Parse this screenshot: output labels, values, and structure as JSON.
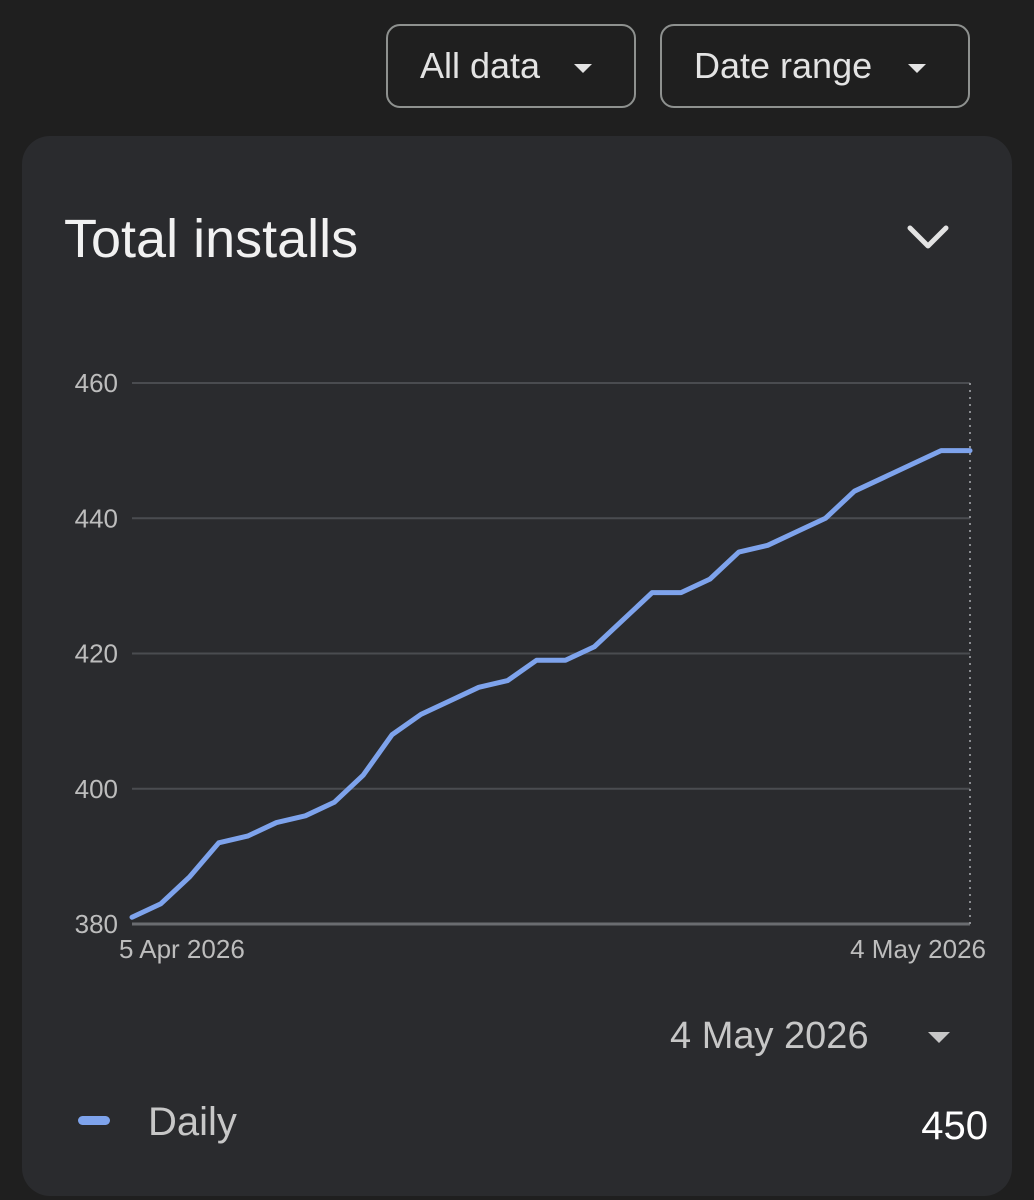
{
  "filters": {
    "all_data_label": "All data",
    "date_range_label": "Date range"
  },
  "card": {
    "title": "Total installs",
    "collapse_icon": "chevron-down-icon"
  },
  "selected_date": "4 May 2026",
  "legend": {
    "label": "Daily",
    "value": "450",
    "color": "#7ea3ec"
  },
  "colors": {
    "background": "#1f1f1f",
    "card": "#2a2b2e",
    "line": "#7ea3ec",
    "grid": "#4a4c50"
  },
  "chart_data": {
    "type": "line",
    "title": "Total installs",
    "xlabel": "",
    "ylabel": "",
    "x_start_label": "5 Apr 2026",
    "x_end_label": "4 May 2026",
    "x": [
      "5 Apr 2026",
      "6 Apr 2026",
      "7 Apr 2026",
      "8 Apr 2026",
      "9 Apr 2026",
      "10 Apr 2026",
      "11 Apr 2026",
      "12 Apr 2026",
      "13 Apr 2026",
      "14 Apr 2026",
      "15 Apr 2026",
      "16 Apr 2026",
      "17 Apr 2026",
      "18 Apr 2026",
      "19 Apr 2026",
      "20 Apr 2026",
      "21 Apr 2026",
      "22 Apr 2026",
      "23 Apr 2026",
      "24 Apr 2026",
      "25 Apr 2026",
      "26 Apr 2026",
      "27 Apr 2026",
      "28 Apr 2026",
      "29 Apr 2026",
      "30 Apr 2026",
      "1 May 2026",
      "2 May 2026",
      "3 May 2026",
      "4 May 2026"
    ],
    "yticks": [
      380,
      400,
      420,
      440,
      460
    ],
    "ylim": [
      380,
      460
    ],
    "grid": true,
    "series": [
      {
        "name": "Daily",
        "values": [
          381,
          383,
          387,
          392,
          393,
          395,
          396,
          398,
          402,
          408,
          411,
          413,
          415,
          416,
          419,
          419,
          421,
          425,
          429,
          429,
          431,
          435,
          436,
          438,
          440,
          444,
          446,
          448,
          450,
          450
        ]
      }
    ]
  }
}
